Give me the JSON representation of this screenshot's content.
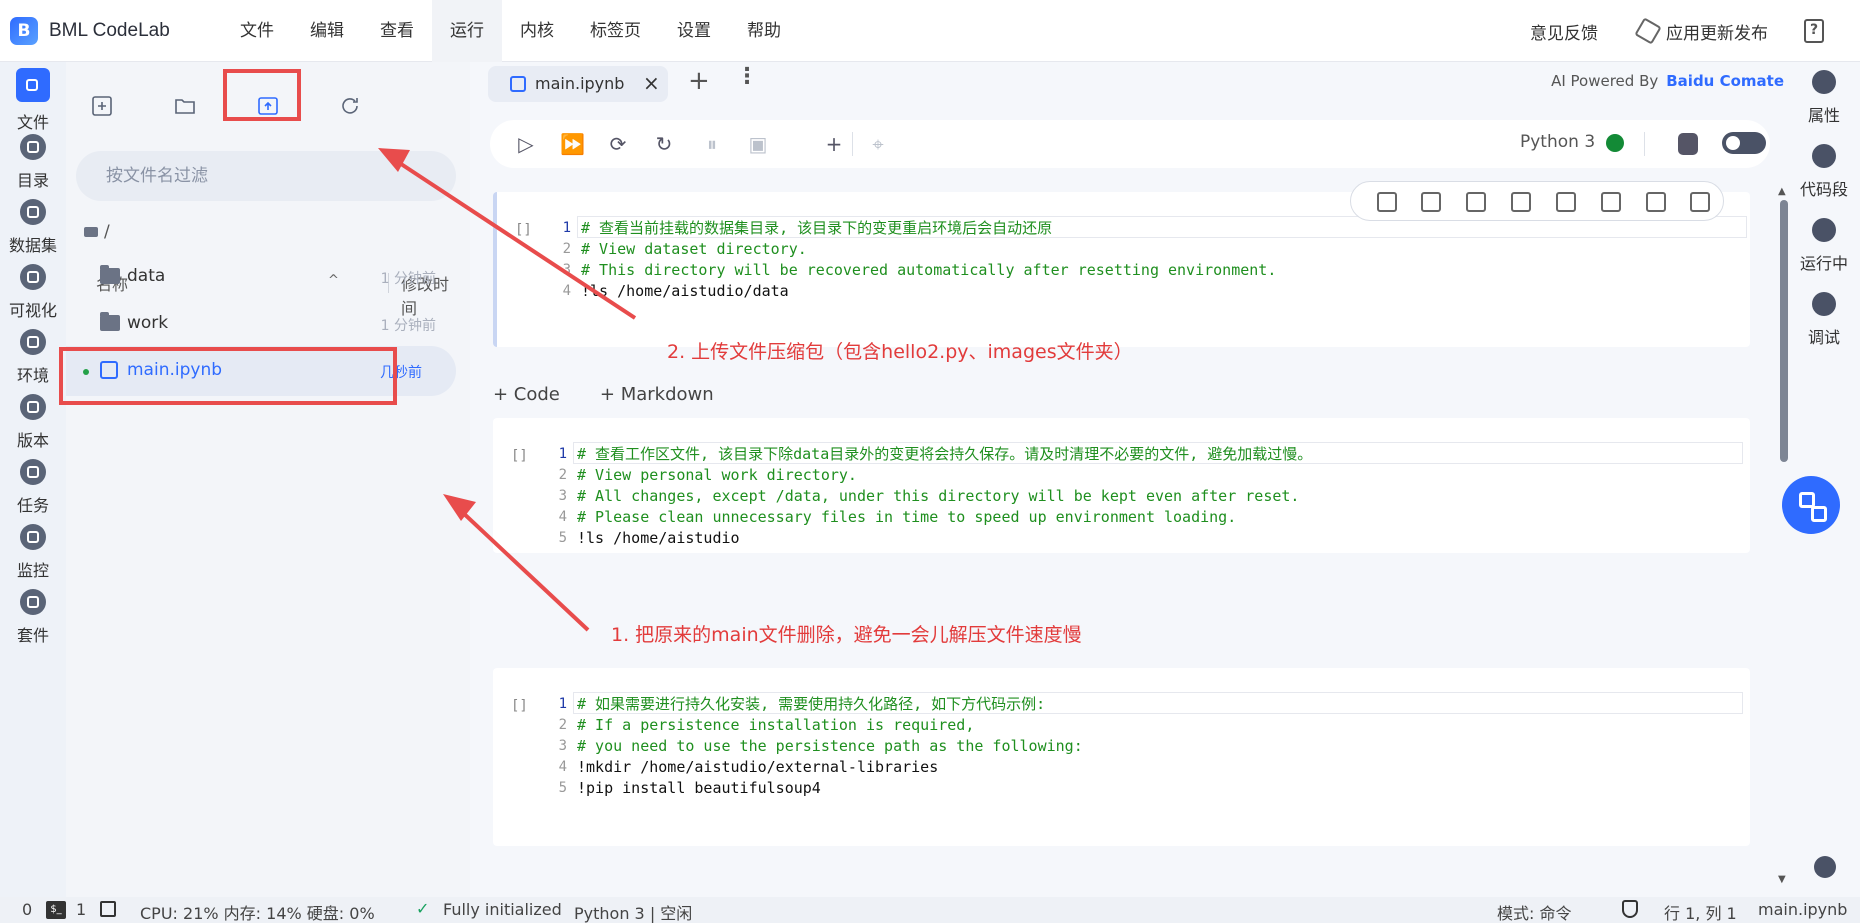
{
  "app": {
    "title": "BML CodeLab",
    "logo_letter": "B",
    "menu": [
      "文件",
      "编辑",
      "查看",
      "运行",
      "内核",
      "标签页",
      "设置",
      "帮助"
    ],
    "active_menu": "运行",
    "feedback": "意见反馈",
    "release": "应用更新发布",
    "help_glyph": "?"
  },
  "left_rail": [
    {
      "label": "文件",
      "icon": "folder-icon"
    },
    {
      "label": "目录",
      "icon": "toc-icon"
    },
    {
      "label": "数据集",
      "icon": "dataset-icon"
    },
    {
      "label": "可视化",
      "icon": "chart-icon"
    },
    {
      "label": "环境",
      "icon": "environment-icon"
    },
    {
      "label": "版本",
      "icon": "version-icon"
    },
    {
      "label": "任务",
      "icon": "task-icon"
    },
    {
      "label": "监控",
      "icon": "monitor-icon"
    },
    {
      "label": "套件",
      "icon": "suite-icon"
    }
  ],
  "file_panel": {
    "filter_placeholder": "按文件名过滤",
    "breadcrumb": "/",
    "col_name": "名称",
    "col_mtime": "修改时间",
    "sort_glyph": "^",
    "files": [
      {
        "name": "data",
        "time": "1 分钟前",
        "type": "folder"
      },
      {
        "name": "work",
        "time": "1 分钟前",
        "type": "folder"
      },
      {
        "name": "main.ipynb",
        "time": "几秒前",
        "type": "notebook"
      }
    ]
  },
  "tab": {
    "name": "main.ipynb",
    "close_glyph": "×",
    "add_glyph": "+",
    "more_glyph": "⋮"
  },
  "ai": {
    "prefix": "AI Powered By",
    "brand": "Baidu Comate"
  },
  "toolbar": {
    "kernel": "Python 3",
    "kernel_status_color": "#138a36",
    "buttons": [
      {
        "glyph": "▷",
        "icon": "run-icon"
      },
      {
        "glyph": "⏩",
        "icon": "run-all-icon"
      },
      {
        "glyph": "⟳",
        "icon": "run-restart-icon"
      },
      {
        "glyph": "↻",
        "icon": "restart-icon"
      },
      {
        "glyph": "⏸",
        "icon": "interrupt-icon"
      },
      {
        "glyph": "▣",
        "icon": "save-icon"
      },
      {
        "glyph": "+",
        "icon": "add-cell-icon"
      },
      {
        "glyph": "⌖",
        "icon": "locate-icon"
      }
    ]
  },
  "cells": [
    {
      "prompt": "[]",
      "lines": [
        {
          "n": "1",
          "text": "# 查看当前挂载的数据集目录, 该目录下的变更重启环境后会自动还原",
          "kind": "cmt"
        },
        {
          "n": "2",
          "text": "# View dataset directory.",
          "kind": "cmt"
        },
        {
          "n": "3",
          "text": "# This directory will be recovered automatically after resetting environment.",
          "kind": "cmt"
        },
        {
          "n": "4",
          "text": "!ls /home/aistudio/data",
          "kind": "cmd"
        }
      ]
    },
    {
      "prompt": "[]",
      "lines": [
        {
          "n": "1",
          "text": "# 查看工作区文件, 该目录下除data目录外的变更将会持久保存。请及时清理不必要的文件, 避免加载过慢。",
          "kind": "cmt"
        },
        {
          "n": "2",
          "text": "# View personal work directory.",
          "kind": "cmt"
        },
        {
          "n": "3",
          "text": "# All changes, except /data, under this directory will be kept even after reset.",
          "kind": "cmt"
        },
        {
          "n": "4",
          "text": "# Please clean unnecessary files in time to speed up environment loading.",
          "kind": "cmt"
        },
        {
          "n": "5",
          "text": "!ls /home/aistudio",
          "kind": "cmd"
        }
      ]
    },
    {
      "prompt": "[]",
      "lines": [
        {
          "n": "1",
          "text": "# 如果需要进行持久化安装, 需要使用持久化路径, 如下方代码示例:",
          "kind": "cmt"
        },
        {
          "n": "2",
          "text": "# If a persistence installation is required,",
          "kind": "cmt"
        },
        {
          "n": "3",
          "text": "# you need to use the persistence path as the following:",
          "kind": "cmt"
        },
        {
          "n": "4",
          "text": "!mkdir /home/aistudio/external-libraries",
          "kind": "cmd"
        },
        {
          "n": "5",
          "text": "!pip install beautifulsoup4",
          "kind": "cmd"
        }
      ]
    }
  ],
  "add_code": "+ Code",
  "add_markdown": "+ Markdown",
  "right_rail": [
    {
      "label": "属性",
      "icon": "gears-icon"
    },
    {
      "label": "代码段",
      "icon": "snippet-icon"
    },
    {
      "label": "运行中",
      "icon": "running-icon"
    },
    {
      "label": "调试",
      "icon": "debug-icon"
    }
  ],
  "annotations": {
    "upload_note": "2. 上传文件压缩包（包含hello2.py、images文件夹）",
    "delete_note": "1. 把原来的main文件删除，避免一会儿解压文件速度慢"
  },
  "status": {
    "left_count": "0",
    "term_count": "1",
    "term_glyph": "$_",
    "resources": "CPU:  21% 内存:  14% 硬盘:  0%",
    "init": "Fully initialized",
    "kernel": "Python 3 | 空闲",
    "mode": "模式:  命令",
    "position": "行 1,  列 1",
    "file": "main.ipynb",
    "check_glyph": "✓"
  },
  "colors": {
    "accent": "#2f6bff",
    "annotation": "#e84c4c"
  }
}
